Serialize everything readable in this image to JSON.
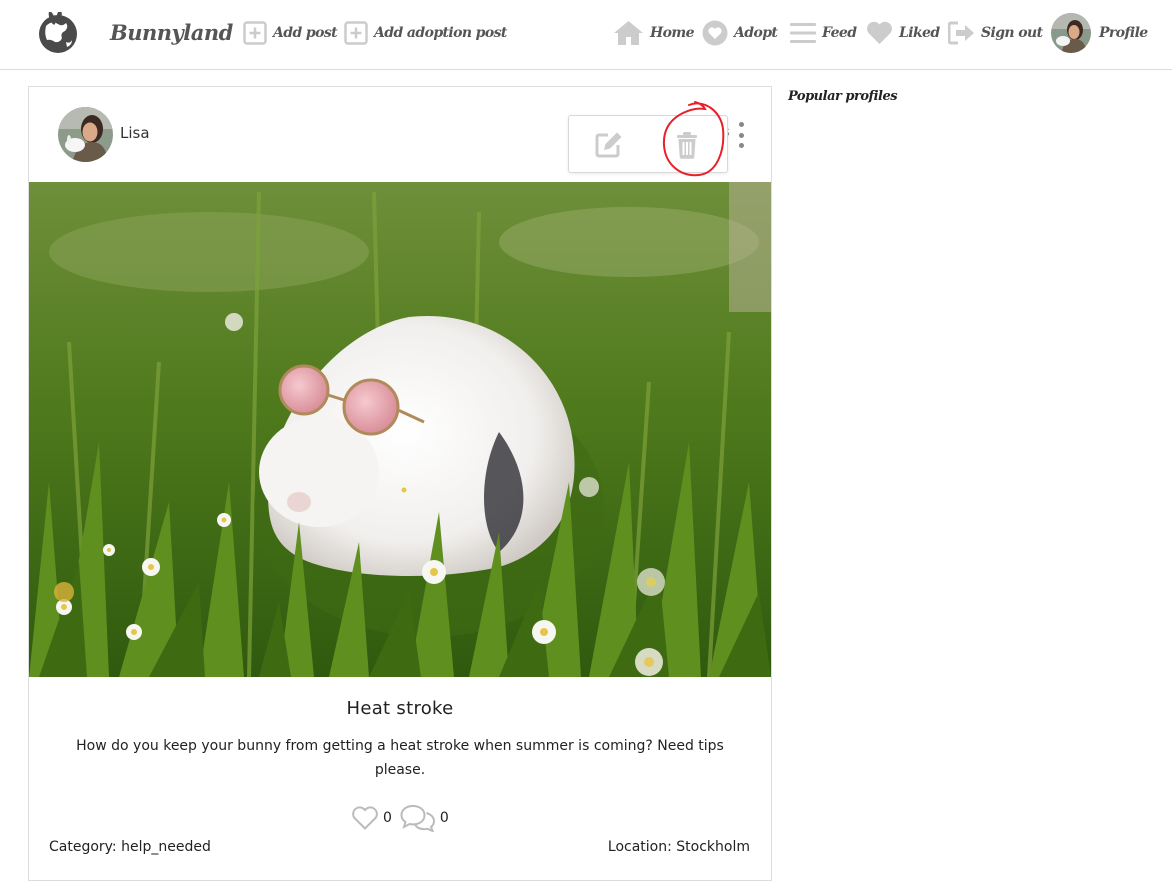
{
  "navbar": {
    "brand": "Bunnyland",
    "add_post": "Add post",
    "add_adoption_post": "Add adoption post",
    "home": "Home",
    "adopt": "Adopt",
    "feed": "Feed",
    "liked": "Liked",
    "sign_out": "Sign out",
    "profile": "Profile"
  },
  "icons": {
    "brand": "globe-bunny-icon",
    "add_post": "plus-square-icon",
    "add_adoption_post": "plus-square-icon",
    "home": "home-icon",
    "adopt": "heart-circle-icon",
    "feed": "bars-icon",
    "liked": "heart-icon",
    "sign_out": "sign-out-icon",
    "edit": "edit-icon",
    "delete": "trash-icon",
    "like": "heart-outline-icon",
    "comment": "comments-icon",
    "more": "ellipsis-vertical-icon"
  },
  "post": {
    "author": "Lisa",
    "title": "Heat stroke",
    "body": "How do you keep your bunny from getting a heat stroke when summer is coming? Need tips please.",
    "likes": "0",
    "comments": "0",
    "category": "Category: help_needed",
    "location": "Location: Stockholm",
    "peek_text": "s"
  },
  "sidebar": {
    "title": "Popular profiles"
  },
  "colors": {
    "nav_icon": "#cccccc",
    "nav_text": "#555555",
    "border": "#dcdcdc",
    "annotation": "#e8202a",
    "grass": "#4f7a1c"
  }
}
